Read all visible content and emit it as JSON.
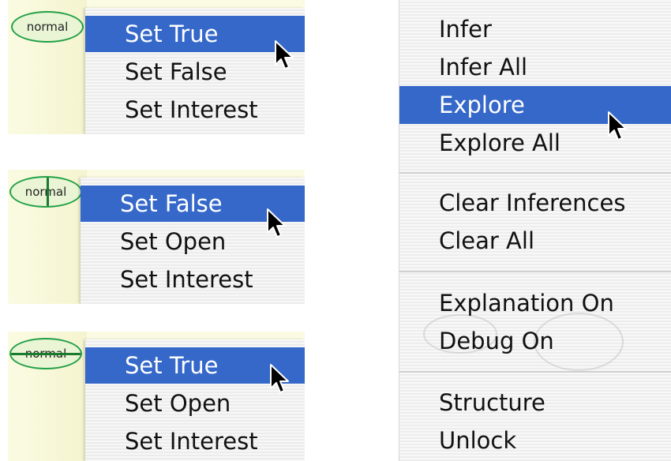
{
  "panels": [
    {
      "node_label": "normal",
      "node_state": "plain",
      "items": [
        "Set True",
        "Set False",
        "Set Interest"
      ],
      "selected_index": 0
    },
    {
      "node_label": "normal",
      "node_state": "vertical-line",
      "items": [
        "Set False",
        "Set Open",
        "Set Interest"
      ],
      "selected_index": 0
    },
    {
      "node_label": "normal",
      "node_state": "strikethrough",
      "items": [
        "Set True",
        "Set Open",
        "Set Interest"
      ],
      "selected_index": 0
    }
  ],
  "context_menu": {
    "groups": [
      [
        "Infer",
        "Infer All",
        "Explore",
        "Explore All"
      ],
      [
        "Clear Inferences",
        "Clear All"
      ],
      [
        "Explanation On",
        "Debug On"
      ],
      [
        "Structure",
        "Unlock"
      ]
    ],
    "selected_label": "Explore"
  },
  "colors": {
    "selection": "#3568c9",
    "node_border": "#22a046",
    "panel_background": "#fbfbe3"
  },
  "icons": {
    "cursor": "arrow-pointer-icon"
  }
}
